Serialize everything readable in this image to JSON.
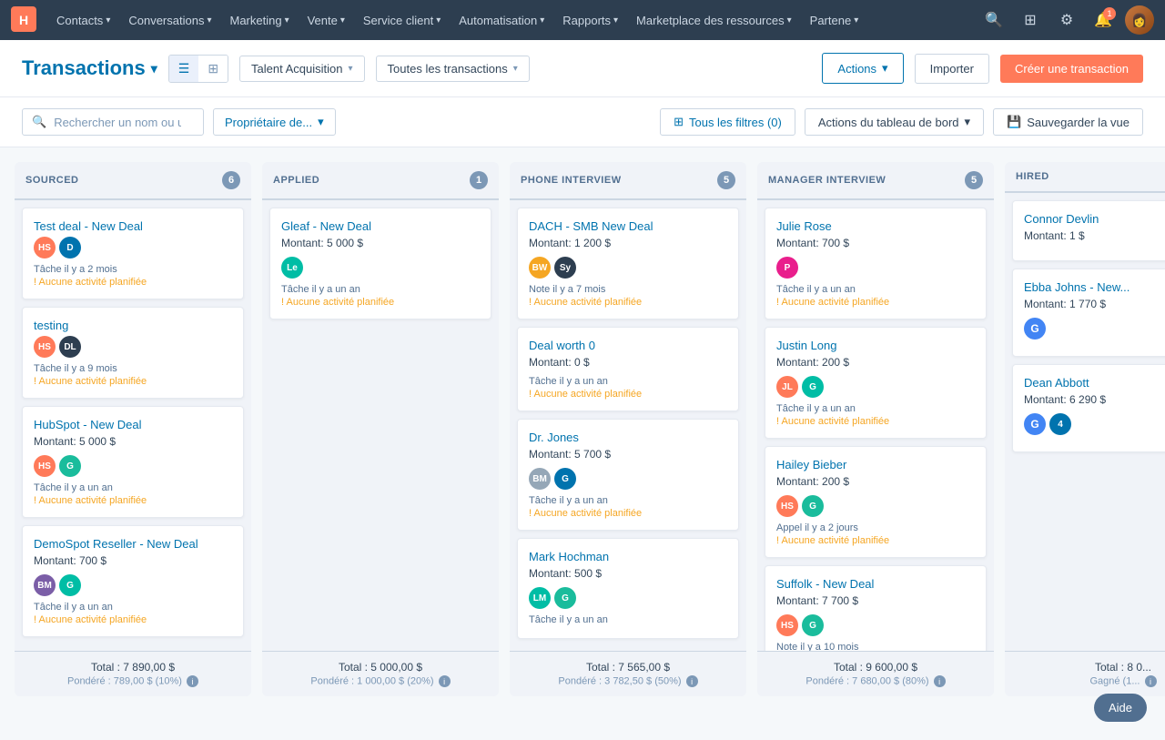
{
  "nav": {
    "items": [
      {
        "label": "Contacts",
        "id": "contacts"
      },
      {
        "label": "Conversations",
        "id": "conversations"
      },
      {
        "label": "Marketing",
        "id": "marketing"
      },
      {
        "label": "Vente",
        "id": "vente"
      },
      {
        "label": "Service client",
        "id": "service"
      },
      {
        "label": "Automatisation",
        "id": "automatisation"
      },
      {
        "label": "Rapports",
        "id": "rapports"
      },
      {
        "label": "Marketplace des ressources",
        "id": "marketplace"
      },
      {
        "label": "Partene",
        "id": "partene"
      }
    ]
  },
  "header": {
    "title": "Transactions",
    "list_view_label": "☰",
    "grid_view_label": "⊞",
    "pipeline_label": "Talent Acquisition",
    "filter_label": "Toutes les transactions",
    "actions_label": "Actions",
    "import_label": "Importer",
    "create_label": "Créer une transaction"
  },
  "filters": {
    "search_placeholder": "Rechercher un nom ou u",
    "owner_label": "Propriétaire de...",
    "all_filters_label": "Tous les filtres (0)",
    "board_actions_label": "Actions du tableau de bord",
    "save_view_label": "Sauvegarder la vue"
  },
  "columns": [
    {
      "id": "sourced",
      "title": "SOURCED",
      "count": 6,
      "cards": [
        {
          "id": "c1",
          "name": "Test deal - New Deal",
          "amount": "",
          "avatars": [
            {
              "color": "av-orange",
              "label": "HS"
            },
            {
              "color": "av-blue",
              "label": "D"
            }
          ],
          "meta": "Tâche il y a 2 mois",
          "warning": "! Aucune activité planifiée"
        },
        {
          "id": "c2",
          "name": "testing",
          "amount": "",
          "avatars": [
            {
              "color": "av-orange",
              "label": "HS"
            },
            {
              "color": "av-dark",
              "label": "DL"
            }
          ],
          "meta": "Tâche il y a 9 mois",
          "warning": "! Aucune activité planifiée"
        },
        {
          "id": "c3",
          "name": "HubSpot - New Deal",
          "amount": "Montant: 5 000 $",
          "avatars": [
            {
              "color": "av-orange",
              "label": "HS"
            },
            {
              "color": "av-teal",
              "label": "G"
            }
          ],
          "meta": "Tâche il y a un an",
          "warning": "! Aucune activité planifiée"
        },
        {
          "id": "c4",
          "name": "DemoSpot Reseller - New Deal",
          "amount": "Montant: 700 $",
          "avatars": [
            {
              "color": "av-purple",
              "label": "BM"
            },
            {
              "color": "av-green",
              "label": "G"
            }
          ],
          "meta": "Tâche il y a un an",
          "warning": "! Aucune activité planifiée"
        }
      ],
      "total": "Total : 7 890,00 $",
      "weighted": "Pondéré : 789,00 $ (10%)"
    },
    {
      "id": "applied",
      "title": "APPLIED",
      "count": 1,
      "cards": [
        {
          "id": "c5",
          "name": "Gleaf - New Deal",
          "amount": "Montant: 5 000 $",
          "avatars": [
            {
              "color": "av-green",
              "label": "Le"
            }
          ],
          "meta": "Tâche il y a un an",
          "warning": "! Aucune activité planifiée"
        }
      ],
      "total": "Total : 5 000,00 $",
      "weighted": "Pondéré : 1 000,00 $ (20%)"
    },
    {
      "id": "phone_interview",
      "title": "PHONE INTERVIEW",
      "count": 5,
      "cards": [
        {
          "id": "c6",
          "name": "DACH - SMB New Deal",
          "amount": "Montant: 1 200 $",
          "avatars": [
            {
              "color": "av-yellow",
              "label": "BW"
            },
            {
              "color": "av-dark",
              "label": "Sy"
            }
          ],
          "meta": "Note il y a 7 mois",
          "warning": "! Aucune activité planifiée"
        },
        {
          "id": "c7",
          "name": "Deal worth 0",
          "amount": "Montant: 0 $",
          "avatars": [],
          "meta": "Tâche il y a un an",
          "warning": "! Aucune activité planifiée"
        },
        {
          "id": "c8",
          "name": "Dr. Jones",
          "amount": "Montant: 5 700 $",
          "avatars": [
            {
              "color": "av-gray",
              "label": "BM"
            },
            {
              "color": "av-blue",
              "label": "G"
            }
          ],
          "meta": "Tâche il y a un an",
          "warning": "! Aucune activité planifiée"
        },
        {
          "id": "c9",
          "name": "Mark Hochman",
          "amount": "Montant: 500 $",
          "avatars": [
            {
              "color": "av-green",
              "label": "LM"
            },
            {
              "color": "av-teal",
              "label": "G"
            }
          ],
          "meta": "Tâche il y a un an",
          "warning": ""
        }
      ],
      "total": "Total : 7 565,00 $",
      "weighted": "Pondéré : 3 782,50 $ (50%)"
    },
    {
      "id": "manager_interview",
      "title": "MANAGER INTERVIEW",
      "count": 5,
      "cards": [
        {
          "id": "c10",
          "name": "Julie Rose",
          "amount": "Montant: 700 $",
          "avatars": [
            {
              "color": "av-pink",
              "label": "P"
            }
          ],
          "meta": "Tâche il y a un an",
          "warning": "! Aucune activité planifiée"
        },
        {
          "id": "c11",
          "name": "Justin Long",
          "amount": "Montant: 200 $",
          "avatars": [
            {
              "color": "av-orange",
              "label": "JL"
            },
            {
              "color": "av-green",
              "label": "G"
            }
          ],
          "meta": "Tâche il y a un an",
          "warning": "! Aucune activité planifiée"
        },
        {
          "id": "c12",
          "name": "Hailey Bieber",
          "amount": "Montant: 200 $",
          "avatars": [
            {
              "color": "av-orange",
              "label": "HS"
            },
            {
              "color": "av-teal",
              "label": "G"
            }
          ],
          "meta": "Appel il y a 2 jours",
          "warning": "! Aucune activité planifiée"
        },
        {
          "id": "c13",
          "name": "Suffolk - New Deal",
          "amount": "Montant: 7 700 $",
          "avatars": [
            {
              "color": "av-orange",
              "label": "HS"
            },
            {
              "color": "av-teal",
              "label": "G"
            }
          ],
          "meta": "Note il y a 10 mois",
          "warning": ""
        }
      ],
      "total": "Total : 9 600,00 $",
      "weighted": "Pondéré : 7 680,00 $ (80%)"
    },
    {
      "id": "hired",
      "title": "HIRED",
      "count": null,
      "cards": [
        {
          "id": "c14",
          "name": "Connor Devlin",
          "amount": "Montant: 1 $",
          "avatars": [],
          "meta": "",
          "warning": ""
        },
        {
          "id": "c15",
          "name": "Ebba Johns - New...",
          "amount": "Montant: 1 770 $",
          "avatars": [
            {
              "color": "av-google",
              "label": "G"
            }
          ],
          "meta": "",
          "warning": ""
        },
        {
          "id": "c16",
          "name": "Dean Abbott",
          "amount": "Montant: 6 290 $",
          "avatars": [
            {
              "color": "av-google",
              "label": "G"
            },
            {
              "color": "av-blue",
              "label": "4"
            }
          ],
          "meta": "",
          "warning": ""
        }
      ],
      "total": "Total : 8 0...",
      "weighted": "Gagné (1..."
    }
  ],
  "help_label": "Aide"
}
